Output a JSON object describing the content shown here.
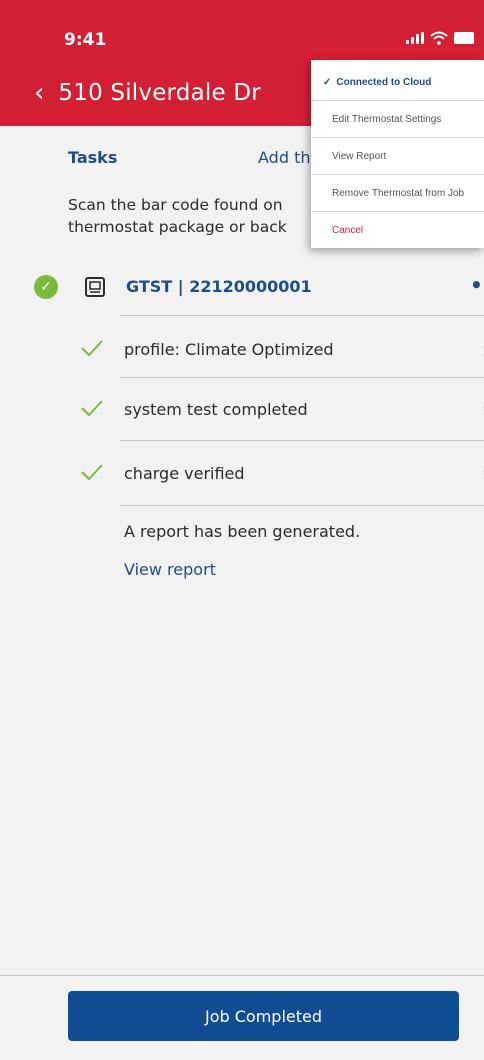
{
  "status_bar": {
    "time": "9:41"
  },
  "header": {
    "title": "510 Silverdale Dr",
    "back_icon": "chevron-left-icon"
  },
  "tasks": {
    "label": "Tasks",
    "add_link": "Add th",
    "instructions": "Scan the bar code found on\nthermostat package or back"
  },
  "device": {
    "label": "GTST | 22120000001",
    "icon": "thermostat-icon"
  },
  "task_items": [
    {
      "label": "profile: Climate Optimized"
    },
    {
      "label": "system test completed"
    },
    {
      "label": "charge verified"
    }
  ],
  "report": {
    "text": "A report has been generated.",
    "link": "View report"
  },
  "footer": {
    "button_label": "Job Completed"
  },
  "menu": {
    "items": [
      "Connected to Cloud",
      "Edit Thermostat Settings",
      "View Report",
      "Remove Thermostat from Job",
      "Cancel"
    ]
  },
  "colors": {
    "brand_red": "#d31f34",
    "primary_blue": "#0f4c93",
    "link_blue": "#1f4d86",
    "check_green": "#7cba3d"
  }
}
